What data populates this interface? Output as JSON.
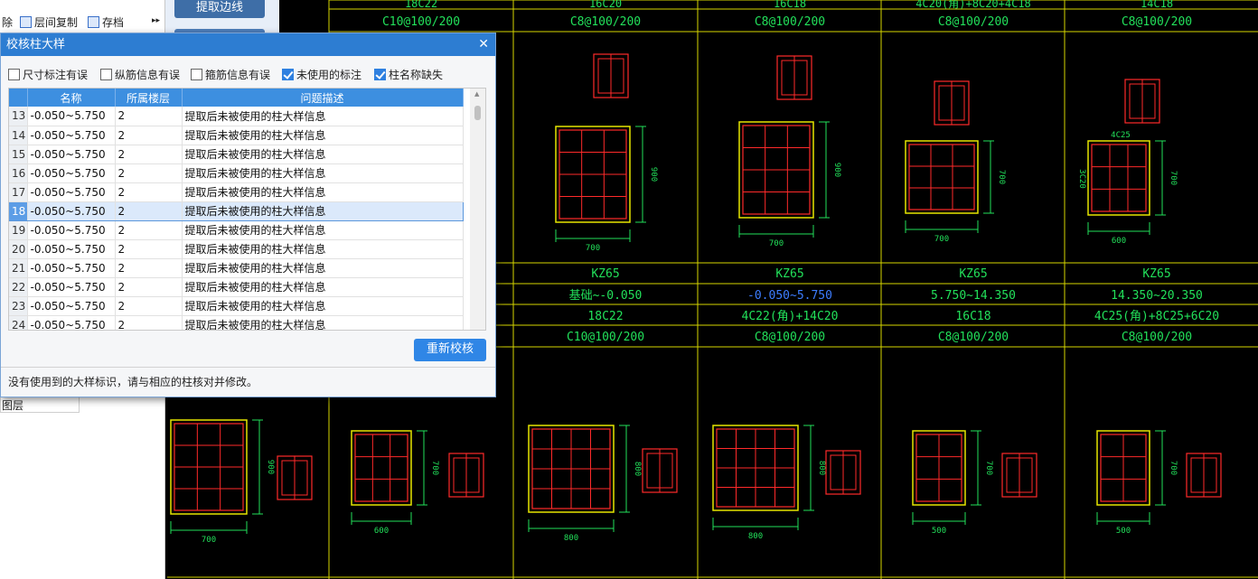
{
  "left_toolbar": {
    "delete_label": "除",
    "copy_floor_label": "层间复制",
    "save_label": "存档",
    "more_glyph": "▸▸"
  },
  "left_field_value": "图层",
  "command_strip": {
    "extract_edge_label": "提取边线"
  },
  "dialog": {
    "title": "校核柱大样",
    "close_glyph": "✕",
    "filters": [
      {
        "label": "尺寸标注有误",
        "checked": false
      },
      {
        "label": "纵筋信息有误",
        "checked": false
      },
      {
        "label": "箍筋信息有误",
        "checked": false
      },
      {
        "label": "未使用的标注",
        "checked": true
      },
      {
        "label": "柱名称缺失",
        "checked": true
      }
    ],
    "columns": [
      "名称",
      "所属楼层",
      "问题描述"
    ],
    "rows": [
      {
        "n": "13",
        "name": "-0.050~5.750",
        "floor": "2",
        "desc": "提取后未被使用的柱大样信息"
      },
      {
        "n": "14",
        "name": "-0.050~5.750",
        "floor": "2",
        "desc": "提取后未被使用的柱大样信息"
      },
      {
        "n": "15",
        "name": "-0.050~5.750",
        "floor": "2",
        "desc": "提取后未被使用的柱大样信息"
      },
      {
        "n": "16",
        "name": "-0.050~5.750",
        "floor": "2",
        "desc": "提取后未被使用的柱大样信息"
      },
      {
        "n": "17",
        "name": "-0.050~5.750",
        "floor": "2",
        "desc": "提取后未被使用的柱大样信息"
      },
      {
        "n": "18",
        "name": "-0.050~5.750",
        "floor": "2",
        "desc": "提取后未被使用的柱大样信息"
      },
      {
        "n": "19",
        "name": "-0.050~5.750",
        "floor": "2",
        "desc": "提取后未被使用的柱大样信息"
      },
      {
        "n": "20",
        "name": "-0.050~5.750",
        "floor": "2",
        "desc": "提取后未被使用的柱大样信息"
      },
      {
        "n": "21",
        "name": "-0.050~5.750",
        "floor": "2",
        "desc": "提取后未被使用的柱大样信息"
      },
      {
        "n": "22",
        "name": "-0.050~5.750",
        "floor": "2",
        "desc": "提取后未被使用的柱大样信息"
      },
      {
        "n": "23",
        "name": "-0.050~5.750",
        "floor": "2",
        "desc": "提取后未被使用的柱大样信息"
      },
      {
        "n": "24",
        "name": "-0.050~5.750",
        "floor": "2",
        "desc": "提取后未被使用的柱大样信息"
      }
    ],
    "selected_row": "18",
    "recheck_label": "重新校核",
    "message": "没有使用到的大样标识，请与相应的柱核对并修改。"
  },
  "cad": {
    "top_labels_row1": [
      "18C22",
      "16C20",
      "16C18",
      "4C20(角)+8C20+4C18",
      "14C18"
    ],
    "top_labels_row2": [
      "C10@100/200",
      "C8@100/200",
      "C8@100/200",
      "C8@100/200",
      "C8@100/200"
    ],
    "top_dims": [
      {
        "h": "900",
        "w": "700"
      },
      {
        "h": "900",
        "w": "700"
      },
      {
        "h": "700",
        "w": "700"
      },
      {
        "h": "700",
        "w": "600"
      }
    ],
    "top_small_label": "4C25",
    "top_left_dim": "3C20",
    "mid_names": [
      "KZ65",
      "KZ65",
      "KZ65",
      "KZ65"
    ],
    "mid_elevations": [
      "基础~-0.050",
      "-0.050~5.750",
      "5.750~14.350",
      "14.350~20.350"
    ],
    "mid_bars": [
      "18C22",
      "4C22(角)+14C20",
      "16C18",
      "4C25(角)+8C25+6C20"
    ],
    "mid_stirrups": [
      "C10@100/200",
      "C8@100/200",
      "C8@100/200",
      "C8@100/200"
    ],
    "bottom_dims": [
      {
        "h": "900",
        "w": "700"
      },
      {
        "h": "700",
        "w": "600"
      },
      {
        "h": "800",
        "w": "800"
      },
      {
        "h": "800",
        "w": "800"
      },
      {
        "h": "700",
        "w": "500"
      },
      {
        "h": "700",
        "w": "500"
      }
    ],
    "colors": {
      "grid": "#d6d600",
      "label": "#22e05a",
      "highlight": "#3d7dff",
      "rebar": "#ff2a2a",
      "section": "#e6e600",
      "dim": "#22e05a"
    }
  }
}
